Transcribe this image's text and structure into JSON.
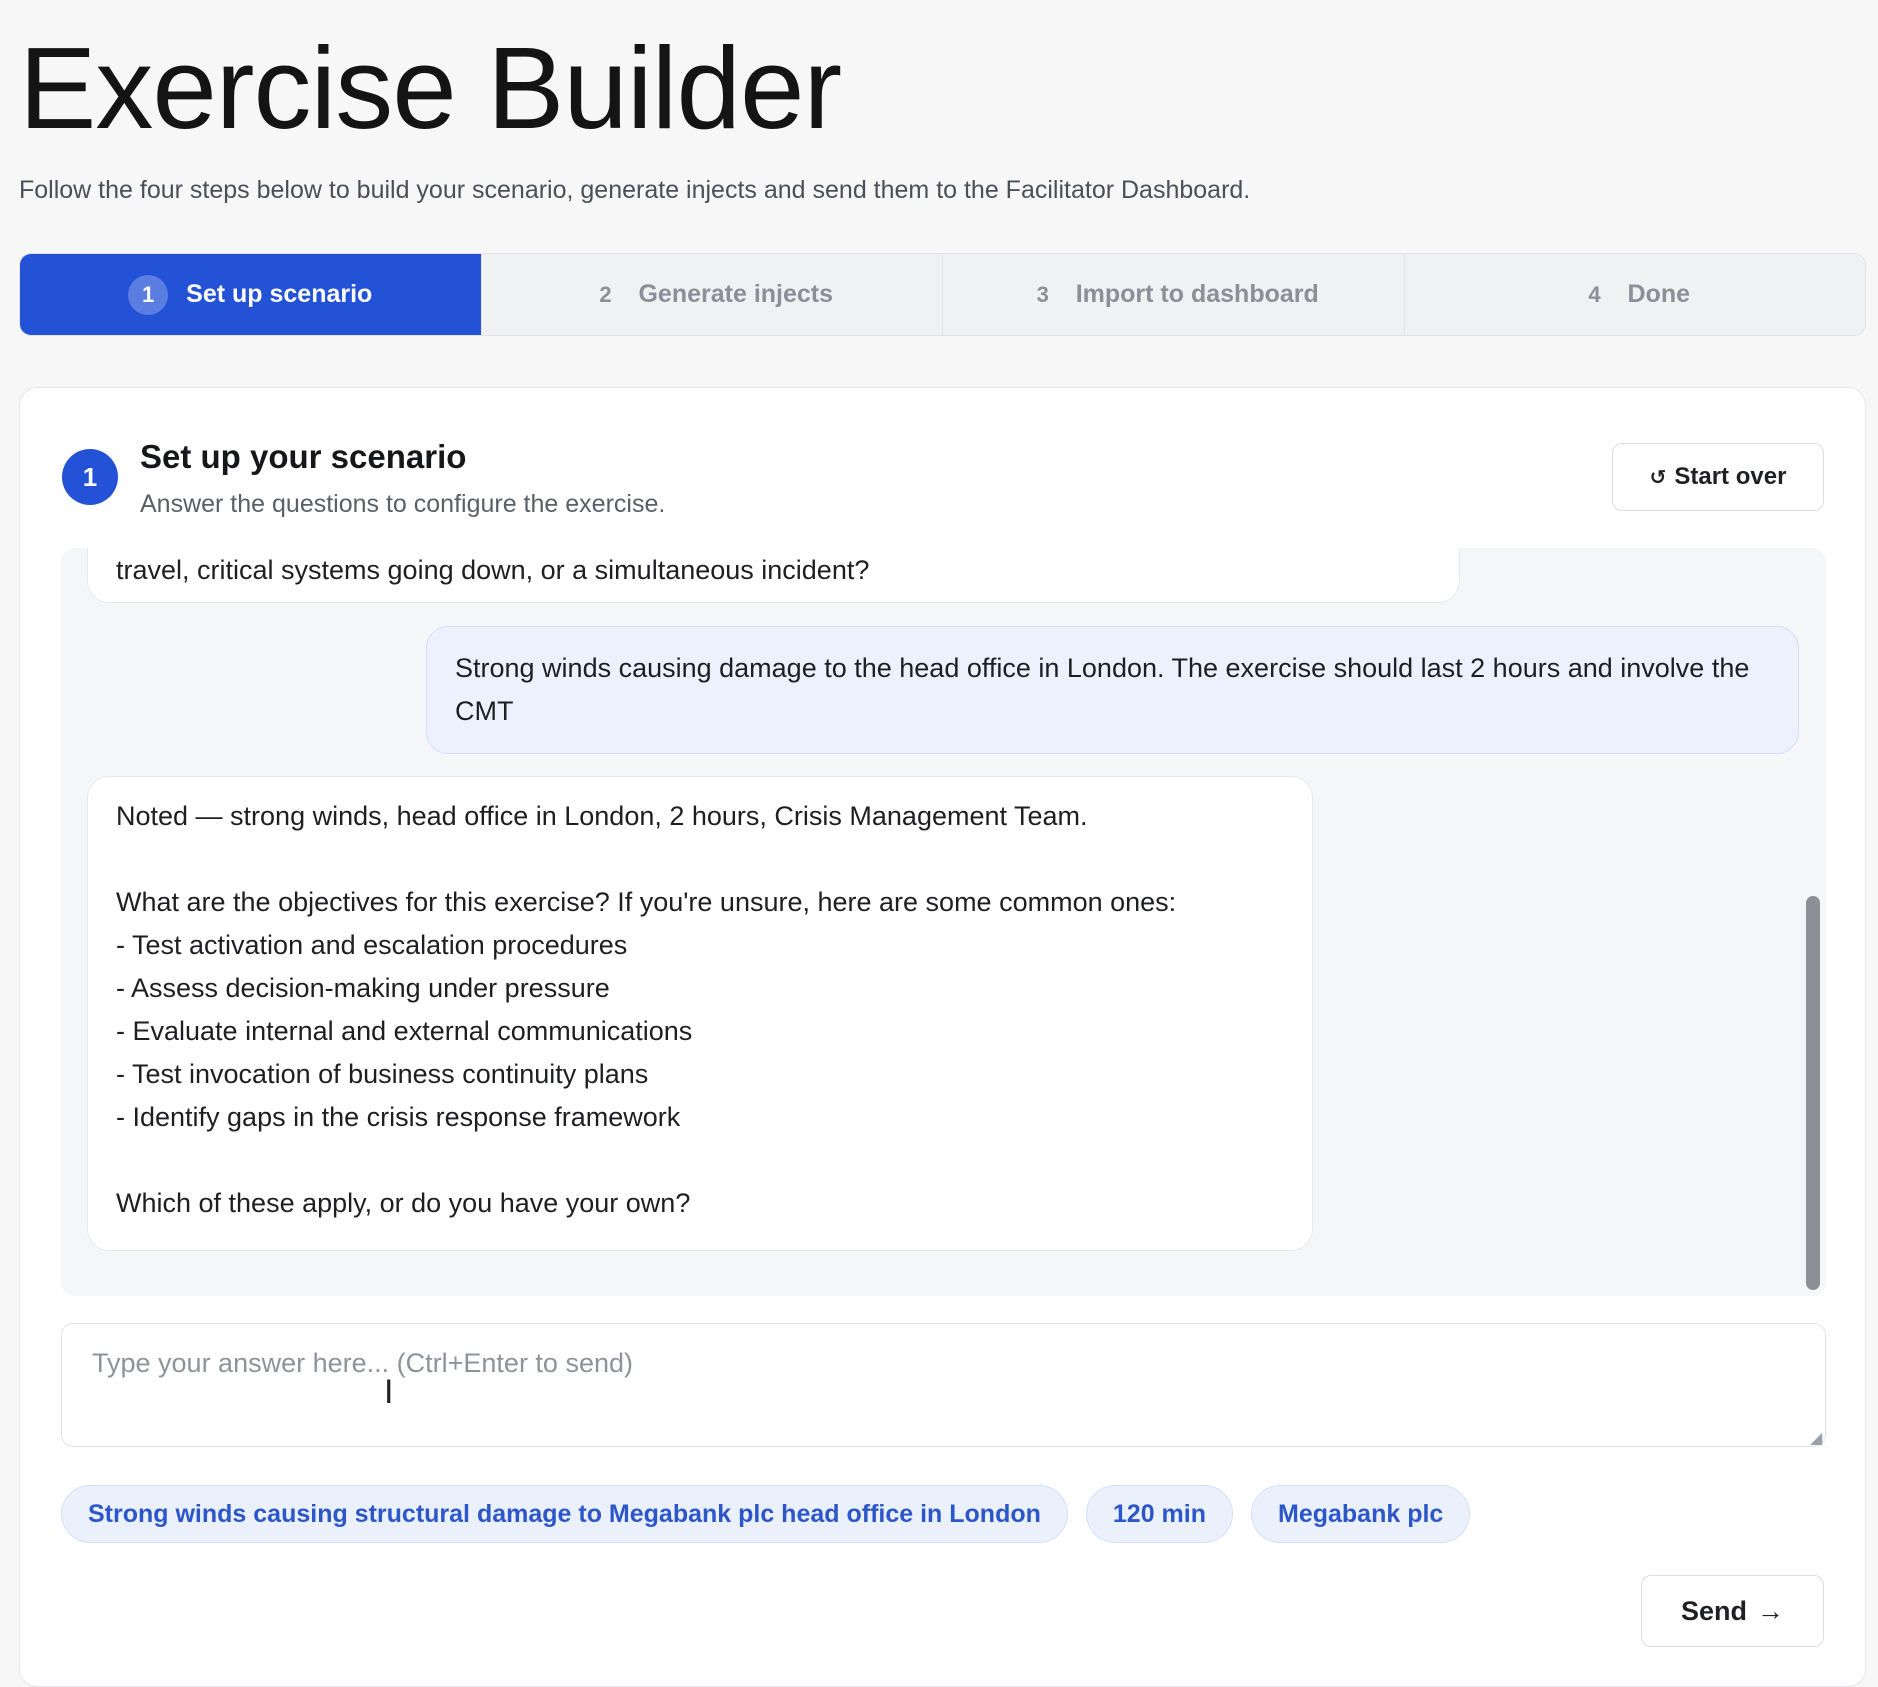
{
  "header": {
    "title": "Exercise Builder",
    "subtitle": "Follow the four steps below to build your scenario, generate injects and send them to the Facilitator Dashboard."
  },
  "stepper": {
    "steps": [
      {
        "num": "1",
        "label": "Set up scenario",
        "active": true
      },
      {
        "num": "2",
        "label": "Generate injects",
        "active": false
      },
      {
        "num": "3",
        "label": "Import to dashboard",
        "active": false
      },
      {
        "num": "4",
        "label": "Done",
        "active": false
      }
    ]
  },
  "card": {
    "badge": "1",
    "title": "Set up your scenario",
    "subtitle": "Answer the questions to configure the exercise.",
    "start_over_icon": "↺",
    "start_over_label": "Start over"
  },
  "chat": {
    "messages": [
      {
        "role": "assistant",
        "text": "travel, critical systems going down, or a simultaneous incident?"
      },
      {
        "role": "user",
        "text": "Strong winds causing damage to the head office in London. The exercise should last 2 hours and involve the CMT"
      },
      {
        "role": "assistant",
        "lines": [
          "Noted — strong winds, head office in London, 2 hours, Crisis Management Team.",
          "",
          "What are the objectives for this exercise? If you're unsure, here are some common ones:",
          "- Test activation and escalation procedures",
          "- Assess decision-making under pressure",
          "- Evaluate internal and external communications",
          "- Test invocation of business continuity plans",
          "- Identify gaps in the crisis response framework",
          "",
          "Which of these apply, or do you have your own?"
        ]
      }
    ]
  },
  "input": {
    "value": "",
    "placeholder": "Type your answer here... (Ctrl+Enter to send)"
  },
  "chips": [
    "Strong winds causing structural damage to Megabank plc head office in London",
    "120 min",
    "Megabank plc"
  ],
  "send": {
    "label": "Send",
    "icon": "→"
  },
  "colors": {
    "accent": "#2352d7",
    "user_bubble": "#ecf1fd",
    "chip_text": "#2c56c9"
  }
}
